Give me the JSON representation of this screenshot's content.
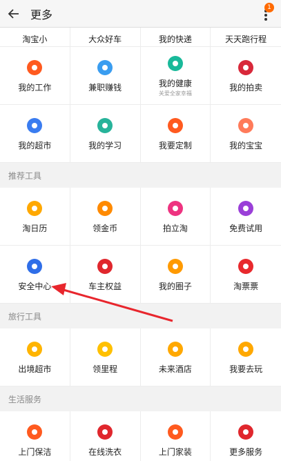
{
  "header": {
    "title": "更多",
    "badge": "1"
  },
  "partial_row": [
    "淘宝小",
    "大众好车",
    "我的快递",
    "天天跑行程"
  ],
  "rows1": [
    {
      "label": "我的工作",
      "icon": "job-icon",
      "color": "#ff5a1f"
    },
    {
      "label": "兼职赚钱",
      "icon": "cloud-money-icon",
      "color": "#3a9df0"
    },
    {
      "label": "我的健康",
      "sub": "关爱全家幸福",
      "icon": "health-heart-icon",
      "color": "#19b99a"
    },
    {
      "label": "我的拍卖",
      "icon": "auction-icon",
      "color": "#d8283a"
    },
    {
      "label": "我的超市",
      "icon": "cart-icon",
      "color": "#3a7cf0"
    },
    {
      "label": "我的学习",
      "icon": "graduation-cap-icon",
      "color": "#27b39a"
    },
    {
      "label": "我要定制",
      "icon": "tools-icon",
      "color": "#ff5a1f"
    },
    {
      "label": "我的宝宝",
      "icon": "baby-face-icon",
      "color": "#ff7b5a"
    }
  ],
  "sections": {
    "recommend": "推荐工具",
    "travel": "旅行工具",
    "life": "生活服务"
  },
  "recommend": [
    {
      "label": "淘日历",
      "icon": "calendar-icon",
      "color": "#ffa800"
    },
    {
      "label": "领金币",
      "icon": "taobao-coin-icon",
      "color": "#ff8a00"
    },
    {
      "label": "拍立淘",
      "icon": "camera-icon",
      "color": "#ee3380"
    },
    {
      "label": "免费试用",
      "icon": "trial-icon",
      "color": "#9a3fd8"
    },
    {
      "label": "安全中心",
      "icon": "police-cap-icon",
      "color": "#2f6ee8"
    },
    {
      "label": "车主权益",
      "icon": "car-icon",
      "color": "#e0272d"
    },
    {
      "label": "我的圈子",
      "icon": "circle-nodes-icon",
      "color": "#ff9a00"
    },
    {
      "label": "淘票票",
      "icon": "ticket-face-icon",
      "color": "#e8292d"
    }
  ],
  "travel": [
    {
      "label": "出境超市",
      "icon": "plane-cart-icon",
      "color": "#ffb400"
    },
    {
      "label": "领里程",
      "icon": "smile-coin-icon",
      "color": "#ffc000"
    },
    {
      "label": "未来酒店",
      "icon": "hotel-icon",
      "color": "#ffa800"
    },
    {
      "label": "我要去玩",
      "icon": "eye-icon",
      "color": "#ffa800"
    }
  ],
  "life": [
    {
      "label": "上门保洁",
      "icon": "broom-icon",
      "color": "#ff5a1f"
    },
    {
      "label": "在线洗衣",
      "icon": "washer-icon",
      "color": "#e0272d"
    },
    {
      "label": "上门家装",
      "icon": "hammer-icon",
      "color": "#ff5a1f"
    },
    {
      "label": "更多服务",
      "icon": "grid-icon",
      "color": "#e0272d"
    }
  ]
}
